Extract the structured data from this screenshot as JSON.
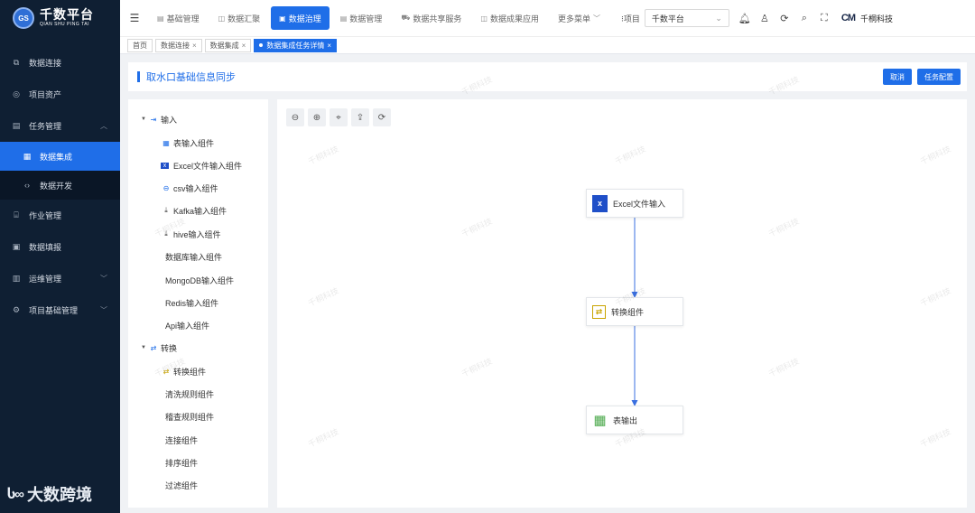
{
  "sidebar": {
    "logo_mark": "GS",
    "logo_title": "千数平台",
    "logo_subtitle": "QIAN SHU PING TAI",
    "items": [
      {
        "label": "数据连接",
        "icon": "external-link-icon"
      },
      {
        "label": "项目资产",
        "icon": "asset-icon"
      },
      {
        "label": "任务管理",
        "icon": "task-icon"
      },
      {
        "label": "数据集成",
        "icon": "grid-icon"
      },
      {
        "label": "数据开发",
        "icon": "code-icon"
      },
      {
        "label": "作业管理",
        "icon": "job-icon"
      },
      {
        "label": "数据填报",
        "icon": "form-icon"
      },
      {
        "label": "运维管理",
        "icon": "ops-icon"
      },
      {
        "label": "项目基础管理",
        "icon": "gear-icon"
      }
    ],
    "brand_watermark": "大数跨境"
  },
  "topnav": {
    "tabs": [
      {
        "label": "基础管理"
      },
      {
        "label": "数据汇聚"
      },
      {
        "label": "数据治理"
      },
      {
        "label": "数据管理"
      },
      {
        "label": "数据共享服务"
      },
      {
        "label": "数据成果应用"
      },
      {
        "label": "更多菜单"
      }
    ],
    "project_label": "项目",
    "project_value": "千数平台",
    "brand_name": "千桐科技",
    "brand_logo": "CM"
  },
  "crumbs": [
    {
      "label": "首页"
    },
    {
      "label": "数据连接"
    },
    {
      "label": "数据集成"
    },
    {
      "label": "数据集成任务详情"
    }
  ],
  "panel": {
    "title": "取水口基础信息同步",
    "cancel_label": "取消",
    "config_label": "任务配置"
  },
  "tree": {
    "input_group": "输入",
    "inputs": [
      "表输入组件",
      "Excel文件输入组件",
      "csv输入组件",
      "Kafka输入组件",
      "hive输入组件",
      "数据库输入组件",
      "MongoDB输入组件",
      "Redis输入组件",
      "Api输入组件"
    ],
    "transform_group": "转换",
    "transforms": [
      "转换组件",
      "清洗规则组件",
      "稽查规则组件",
      "连接组件",
      "排序组件",
      "过滤组件"
    ]
  },
  "flow": {
    "nodes": [
      {
        "label": "Excel文件输入",
        "icon": "excel-icon"
      },
      {
        "label": "转换组件",
        "icon": "transform-icon"
      },
      {
        "label": "表输出",
        "icon": "table-icon"
      }
    ]
  },
  "watermark_text": "千桐科技",
  "colors": {
    "accent": "#1f6ee8",
    "sidebar": "#0f1f33"
  }
}
